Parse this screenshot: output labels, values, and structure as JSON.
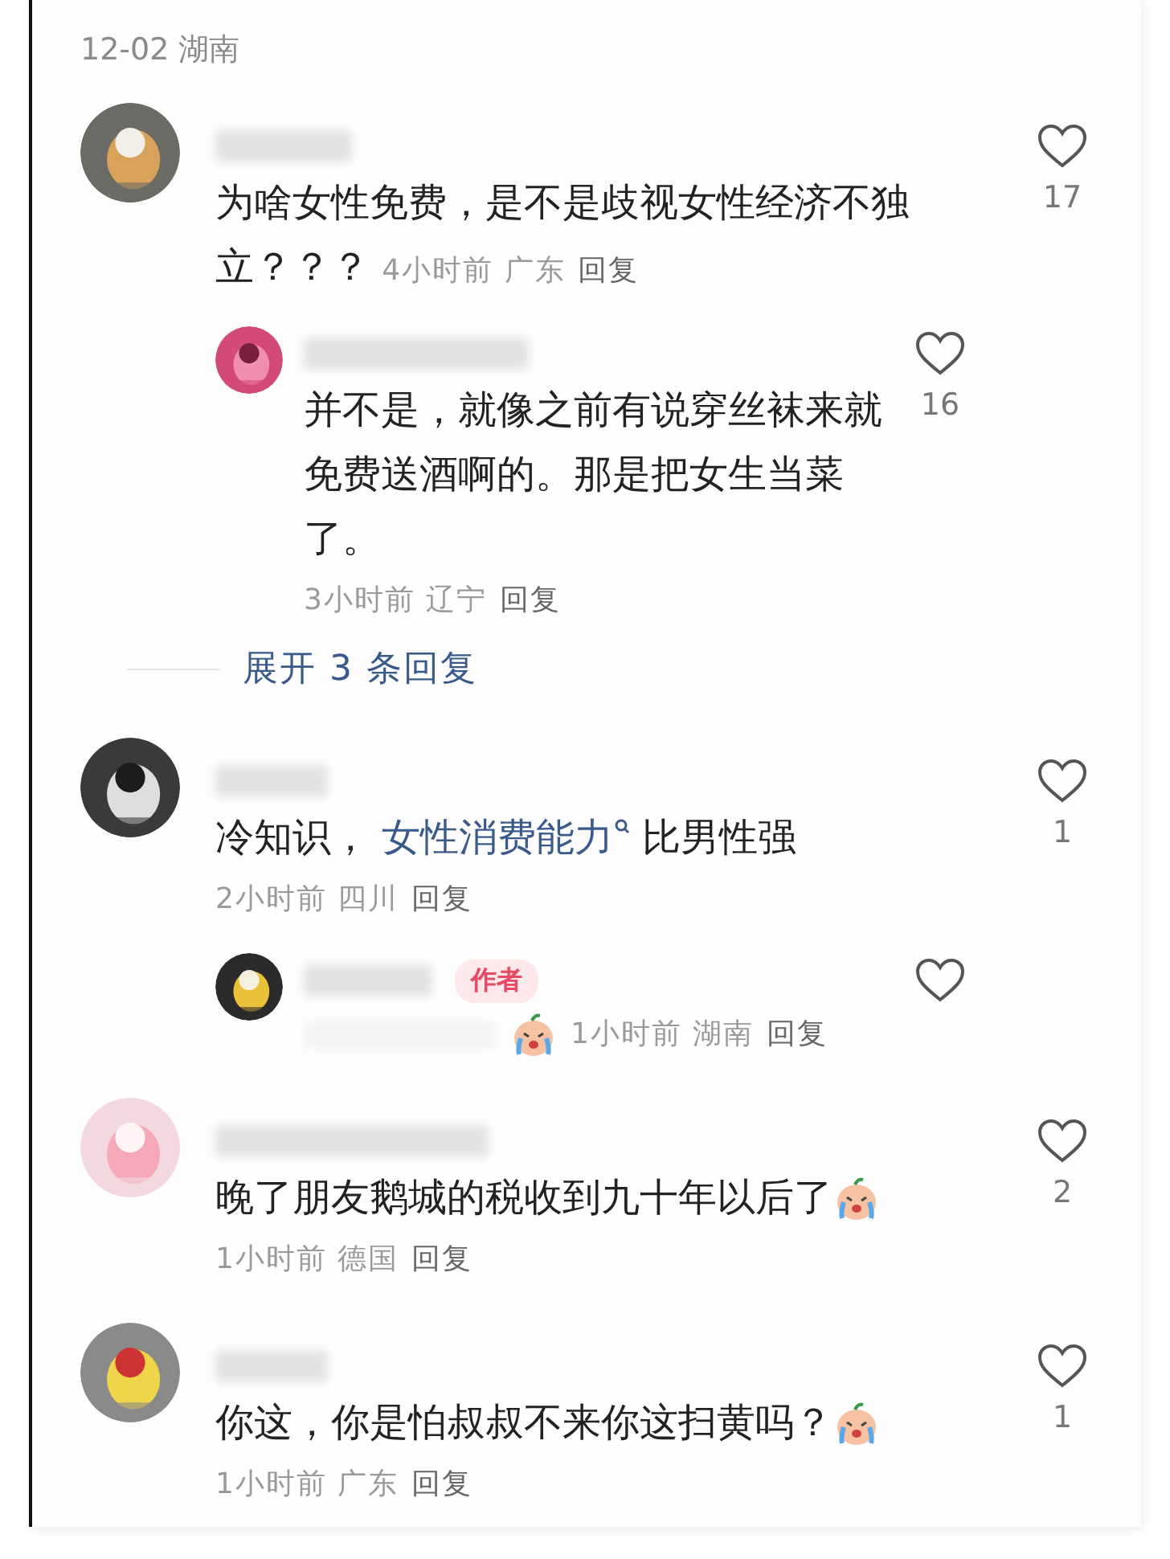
{
  "header": "12-02 湖南",
  "comments": [
    {
      "parts": [
        {
          "kind": "plain",
          "text": "为啥女性免费，是不是歧视女性经济不独立？？？"
        }
      ],
      "meta_inline": true,
      "sticker": false,
      "time": "4小时前",
      "region": "广东",
      "reply": "回复",
      "likes": "17",
      "replies": [
        {
          "parts": [
            {
              "kind": "plain",
              "text": "并不是，就像之前有说穿丝袜来就免费送酒啊的。那是把女生当菜了。"
            }
          ],
          "meta_inline": false,
          "sticker": false,
          "time": "3小时前",
          "region": "辽宁",
          "reply": "回复",
          "likes": "16"
        }
      ],
      "more_replies": "展开 3 条回复"
    },
    {
      "parts": [
        {
          "kind": "plain",
          "text": "冷知识， "
        },
        {
          "kind": "link",
          "text": "女性消费能力"
        },
        {
          "kind": "plain",
          "text": " 比男性强"
        }
      ],
      "meta_inline": false,
      "sticker": false,
      "time": "2小时前",
      "region": "四川",
      "reply": "回复",
      "likes": "1",
      "replies": [
        {
          "badge": "作者",
          "sticker": true,
          "time": "1小时前",
          "region": "湖南",
          "reply": "回复"
        }
      ]
    },
    {
      "parts": [
        {
          "kind": "plain",
          "text": "晚了朋友鹅城的税收到九十年以后了"
        }
      ],
      "meta_inline": false,
      "sticker": true,
      "time": "1小时前",
      "region": "德国",
      "reply": "回复",
      "likes": "2"
    },
    {
      "parts": [
        {
          "kind": "plain",
          "text": "你这，你是怕叔叔不来你这扫黄吗？"
        }
      ],
      "meta_inline": false,
      "sticker": true,
      "time": "1小时前",
      "region": "广东",
      "reply": "回复",
      "likes": "1"
    }
  ]
}
